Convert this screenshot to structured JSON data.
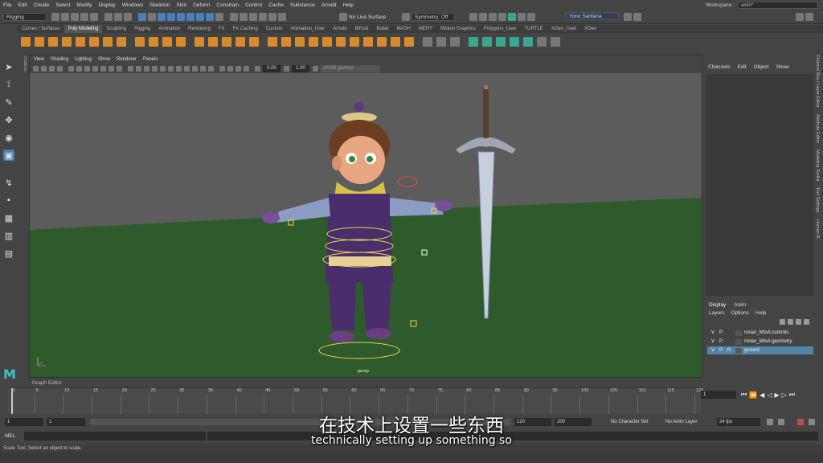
{
  "menubar": {
    "items": [
      "File",
      "Edit",
      "Create",
      "Select",
      "Modify",
      "Display",
      "Windows",
      "Skeleton",
      "Skin",
      "Deform",
      "Constrain",
      "Control",
      "Cache",
      "Substance",
      "Arnold",
      "Help"
    ],
    "workspace_label": "Workspace :",
    "workspace_value": "anim*"
  },
  "statusline": {
    "menuset": "Rigging",
    "live_surface": "No Live Surface",
    "symmetry": "Symmetry: Off",
    "user": "Yono Santana"
  },
  "shelf": {
    "tabs": [
      "Curves / Surfaces",
      "Poly Modeling",
      "Sculpting",
      "Rigging",
      "Animation",
      "Rendering",
      "FX",
      "FX Caching",
      "Custom",
      "Animation_User",
      "Arnold",
      "Bifrost",
      "Bullet",
      "MASH",
      "MERY",
      "Motion Graphics",
      "Polygons_User",
      "TURTLE",
      "XGen_User",
      "XGen"
    ],
    "active_tab": "Poly Modeling"
  },
  "toolbox": {
    "outliner_label": "Outliner"
  },
  "viewport": {
    "menus": [
      "View",
      "Shading",
      "Lighting",
      "Show",
      "Renderer",
      "Panels"
    ],
    "field_1": "0.00",
    "field_2": "1.00",
    "colorspace": "sRGB gamma",
    "camera": "persp"
  },
  "channelbox": {
    "menus": [
      "Channels",
      "Edit",
      "Object",
      "Show"
    ],
    "side_tabs": [
      "Channel Box / Layer Editor",
      "Attribute Editor",
      "Modeling Toolkit",
      "Tool Settings",
      "Human IK"
    ]
  },
  "layers": {
    "tabs": [
      "Display",
      "Anim"
    ],
    "active_tab": "Display",
    "menus": [
      "Layers",
      "Options",
      "Help"
    ],
    "items": [
      {
        "v": "V",
        "p": "P",
        "r": "",
        "name": "ronan_MtoA:controls",
        "selected": false
      },
      {
        "v": "V",
        "p": "P",
        "r": "",
        "name": "ronan_MtoA:geometry",
        "selected": false
      },
      {
        "v": "V",
        "p": "P",
        "r": "R",
        "name": "ground",
        "selected": true
      }
    ]
  },
  "graph_editor_label": "Graph Editor",
  "timeline": {
    "ticks": [
      "1",
      "5",
      "10",
      "15",
      "20",
      "25",
      "30",
      "35",
      "40",
      "45",
      "50",
      "55",
      "60",
      "65",
      "70",
      "75",
      "80",
      "85",
      "90",
      "95",
      "100",
      "105",
      "110",
      "115",
      "120"
    ],
    "current_frame": "1"
  },
  "range": {
    "start": "1",
    "start_inner": "1",
    "end_inner": "120",
    "end": "200",
    "character_set": "No Character Set",
    "anim_layer": "No Anim Layer",
    "fps": "24 fps"
  },
  "cmdline": {
    "mel_label": "MEL"
  },
  "helpline": "Scale Tool: Select an object to scale.",
  "subtitles": {
    "chinese": "在技术上设置一些东西",
    "english": "technically setting up something so"
  }
}
